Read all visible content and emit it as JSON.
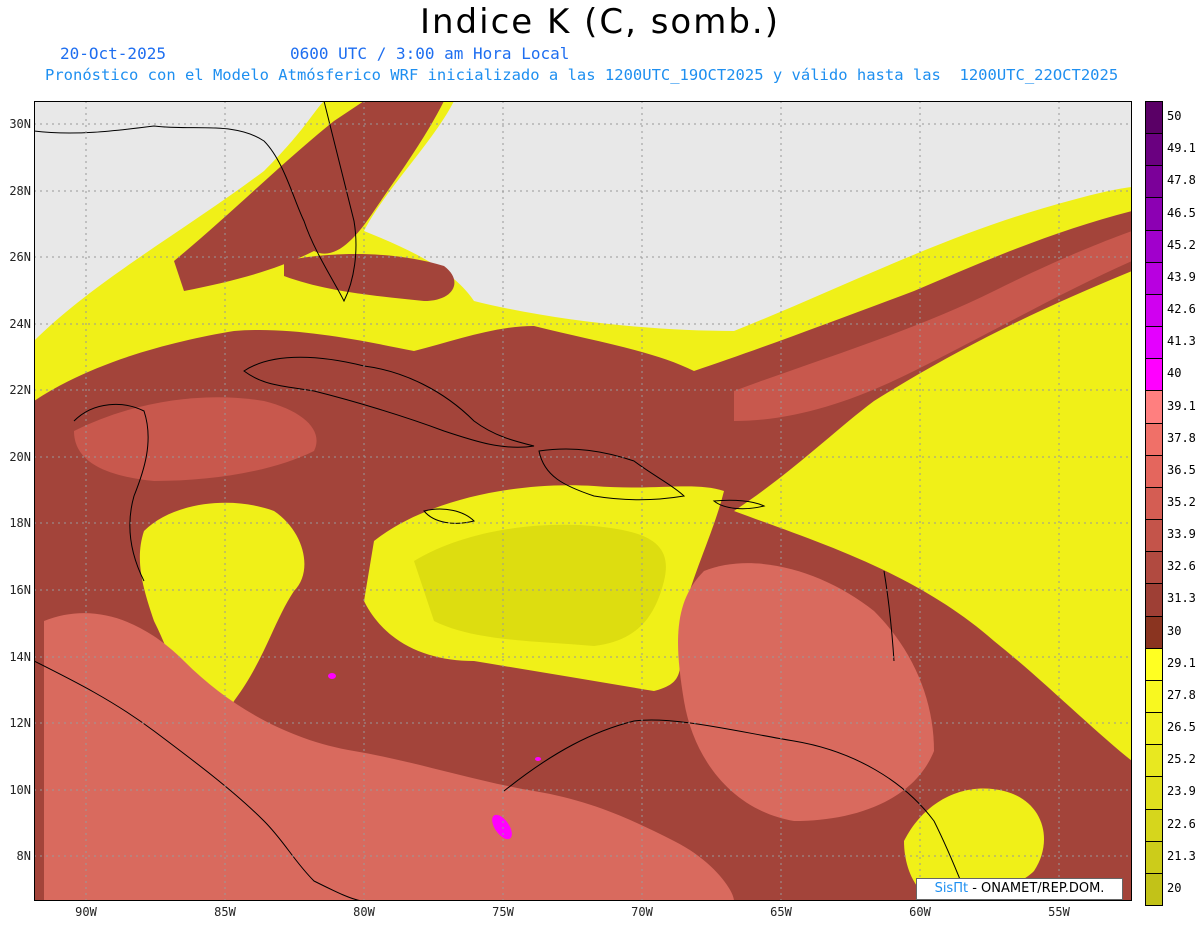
{
  "title": "Indice K (C, somb.)",
  "header": {
    "date": "20-Oct-2025",
    "time": "0600 UTC / 3:00 am Hora Local",
    "forecast": "Pronóstico con el Modelo Atmósferico WRF inicializado a las 1200UTC_19OCT2025 y válido hasta las  1200UTC_22OCT2025"
  },
  "map": {
    "latitude_labels": [
      "30N",
      "28N",
      "26N",
      "24N",
      "22N",
      "20N",
      "18N",
      "16N",
      "14N",
      "12N",
      "10N",
      "8N"
    ],
    "longitude_labels": [
      "90W",
      "85W",
      "80W",
      "75W",
      "70W",
      "65W",
      "60W",
      "55W"
    ],
    "fill_colors": {
      "no_data": "#e8e8e8",
      "yellow_dark": "#dddd10",
      "yellow": "#f4f41a",
      "brown": "#a3443a",
      "salmon": "#d96a5e",
      "magenta": "#ff00ff",
      "coast": "#000000"
    }
  },
  "colorbar": {
    "labels": [
      "50",
      "49.1",
      "47.8",
      "46.5",
      "45.2",
      "43.9",
      "42.6",
      "41.3",
      "40",
      "39.1",
      "37.8",
      "36.5",
      "35.2",
      "33.9",
      "32.6",
      "31.3",
      "30",
      "29.1",
      "27.8",
      "26.5",
      "25.2",
      "23.9",
      "22.6",
      "21.3",
      "20"
    ],
    "colors": [
      "#5a0066",
      "#6a0080",
      "#7b0099",
      "#8c00b3",
      "#a100cc",
      "#b800e0",
      "#d000f0",
      "#e400ff",
      "#ff00ff",
      "#ff7f7f",
      "#f07068",
      "#e4665d",
      "#d45d53",
      "#c4544a",
      "#b14a40",
      "#9e3f35",
      "#8a3420",
      "#ffff22",
      "#f8f820",
      "#f0f020",
      "#e8e820",
      "#e0e01e",
      "#d6d61c",
      "#cccc1a",
      "#c2c218"
    ]
  },
  "credit": {
    "brand": "SisПt",
    "text": "- ONAMET/REP.DOM."
  }
}
